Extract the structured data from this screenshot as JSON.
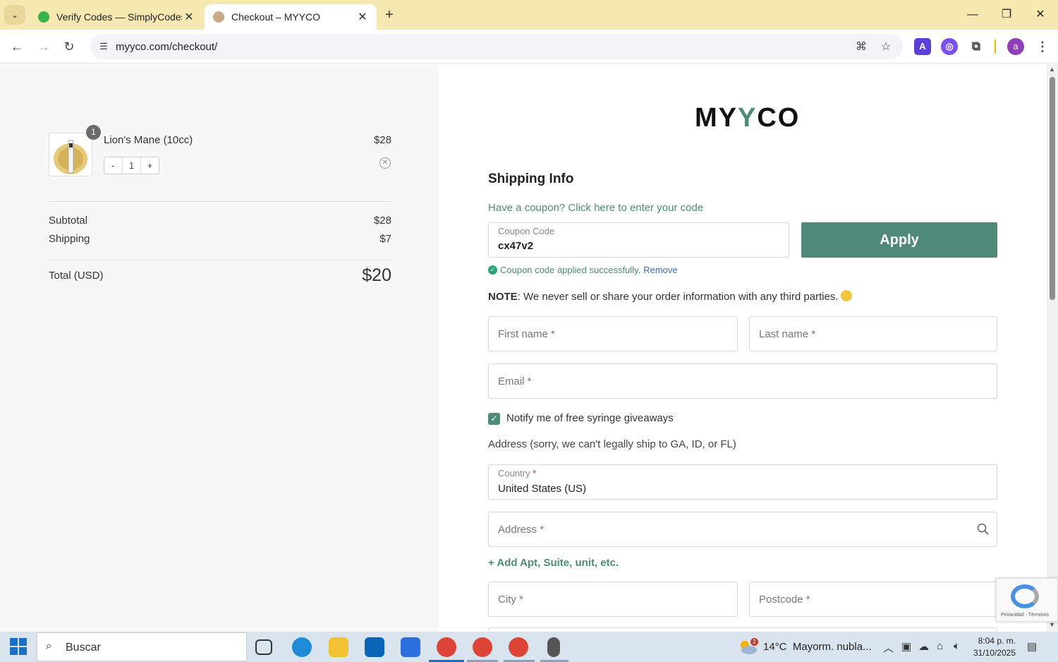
{
  "browser": {
    "tabs": [
      {
        "title": "Verify Codes — SimplyCodes",
        "active": false
      },
      {
        "title": "Checkout – MYYCO",
        "active": true
      }
    ],
    "url": "myyco.com/checkout/",
    "ext_label": "a"
  },
  "summary": {
    "item": {
      "name": "Lion's Mane (10cc)",
      "price": "$28",
      "badge": "1",
      "qty": "1",
      "minus": "-",
      "plus": "+"
    },
    "subtotal_label": "Subtotal",
    "subtotal": "$28",
    "shipping_label": "Shipping",
    "shipping": "$7",
    "total_label": "Total (USD)",
    "total": "$20"
  },
  "form": {
    "logo_pre": "MY",
    "logo_y": "Y",
    "logo_post": "CO",
    "heading": "Shipping Info",
    "coupon_link": "Have a coupon? Click here to enter your code",
    "coupon_label": "Coupon Code",
    "coupon_value": "cx47v2",
    "apply_label": "Apply",
    "success_text": "Coupon code applied successfully.",
    "remove_label": "Remove",
    "note_bold": "NOTE",
    "note_text": ": We never sell or share your order information with any third parties.",
    "first_name_ph": "First name *",
    "last_name_ph": "Last name *",
    "email_ph": "Email *",
    "notify_label": "Notify me of free syringe giveaways",
    "notify_checked": true,
    "address_note": "Address (sorry, we can't legally ship to GA, ID, or FL)",
    "country_label": "Country",
    "country_req": "*",
    "country_value": "United States (US)",
    "address_ph": "Address *",
    "add_apt": "+ Add Apt, Suite, unit, etc.",
    "city_ph": "City *",
    "postcode_ph": "Postcode *"
  },
  "recaptcha": {
    "footer": "Privacidad - Términos"
  },
  "taskbar": {
    "search_placeholder": "Buscar",
    "weather_temp": "14°C",
    "weather_desc": "Mayorm. nubla...",
    "weather_badge": "2",
    "time": "8:04 p. m.",
    "date": "31/10/2025"
  },
  "colors": {
    "brand": "#4f8a78",
    "tabbar": "#f6e8b1"
  }
}
